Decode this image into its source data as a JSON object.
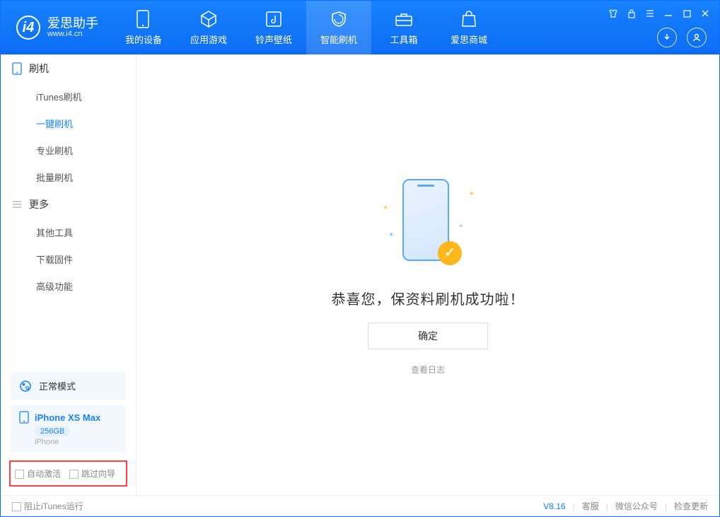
{
  "app": {
    "name_cn": "爱思助手",
    "name_en": "www.i4.cn"
  },
  "nav": [
    {
      "label": "我的设备"
    },
    {
      "label": "应用游戏"
    },
    {
      "label": "铃声壁纸"
    },
    {
      "label": "智能刷机"
    },
    {
      "label": "工具箱"
    },
    {
      "label": "爱思商城"
    }
  ],
  "sidebar": {
    "group1": {
      "title": "刷机",
      "items": [
        "iTunes刷机",
        "一键刷机",
        "专业刷机",
        "批量刷机"
      ]
    },
    "group2": {
      "title": "更多",
      "items": [
        "其他工具",
        "下载固件",
        "高级功能"
      ]
    }
  },
  "mode": {
    "label": "正常模式"
  },
  "device": {
    "name": "iPhone XS Max",
    "storage": "256GB",
    "type": "iPhone"
  },
  "options": {
    "auto_activate": "自动激活",
    "skip_guide": "跳过向导"
  },
  "main": {
    "success": "恭喜您，保资料刷机成功啦！",
    "ok": "确定",
    "view_log": "查看日志"
  },
  "footer": {
    "block_itunes": "阻止iTunes运行",
    "version": "V8.16",
    "support": "客服",
    "wechat": "微信公众号",
    "update": "检查更新"
  }
}
